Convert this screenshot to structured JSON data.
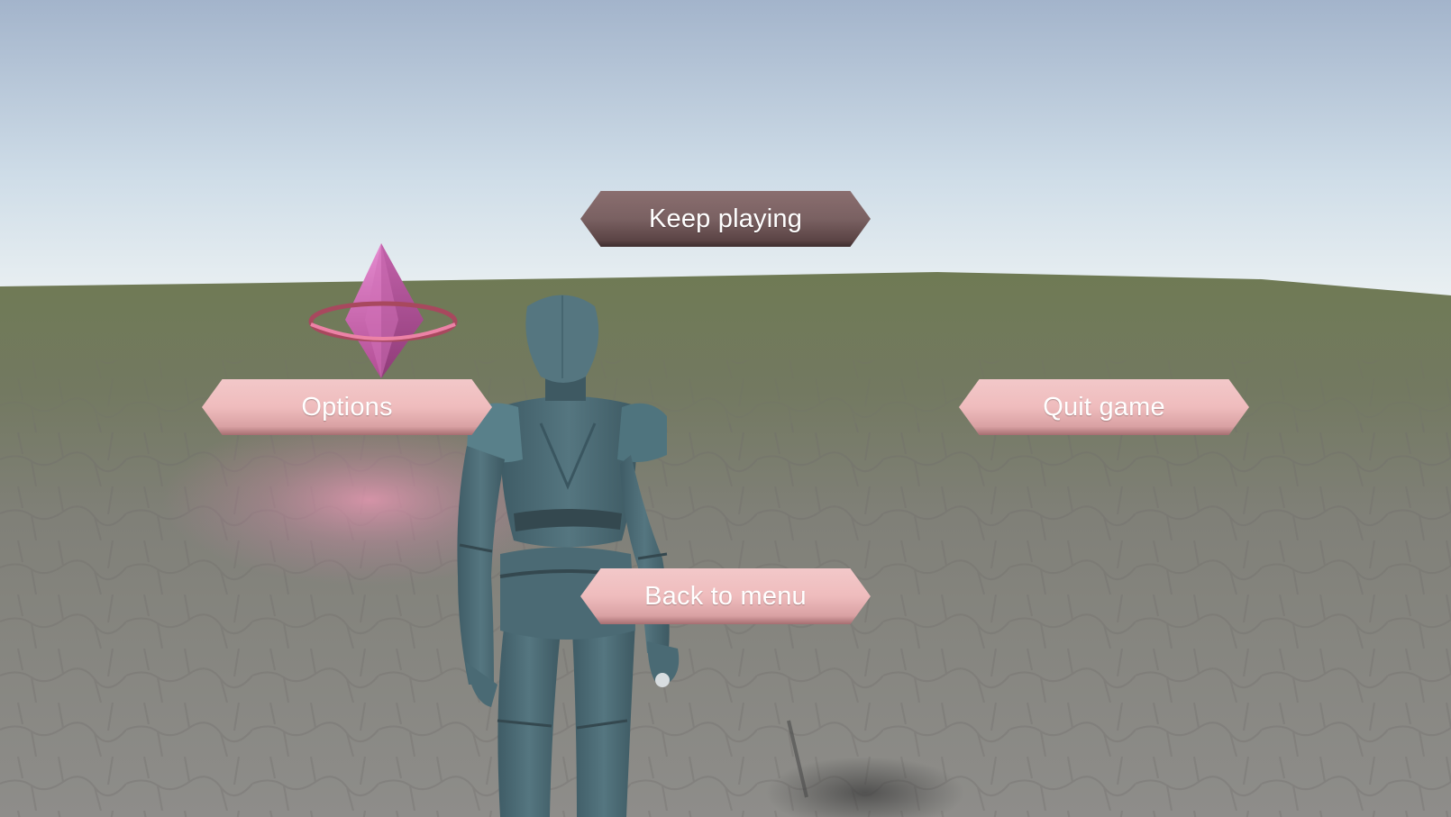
{
  "menu": {
    "keep_playing_label": "Keep playing",
    "options_label": "Options",
    "quit_game_label": "Quit game",
    "back_to_menu_label": "Back to menu",
    "selected": "Keep playing"
  },
  "colors": {
    "selected_button": "#7a6162",
    "normal_button": "#efbcbd",
    "button_text": "#ffffff",
    "sky_top": "#a4b6cc",
    "sky_horizon": "#e6eef2",
    "ground_far": "#707a58",
    "ground_near": "#86847f",
    "character": "#4f6e78",
    "crystal": "#d873b6",
    "ring": "#e07090"
  }
}
